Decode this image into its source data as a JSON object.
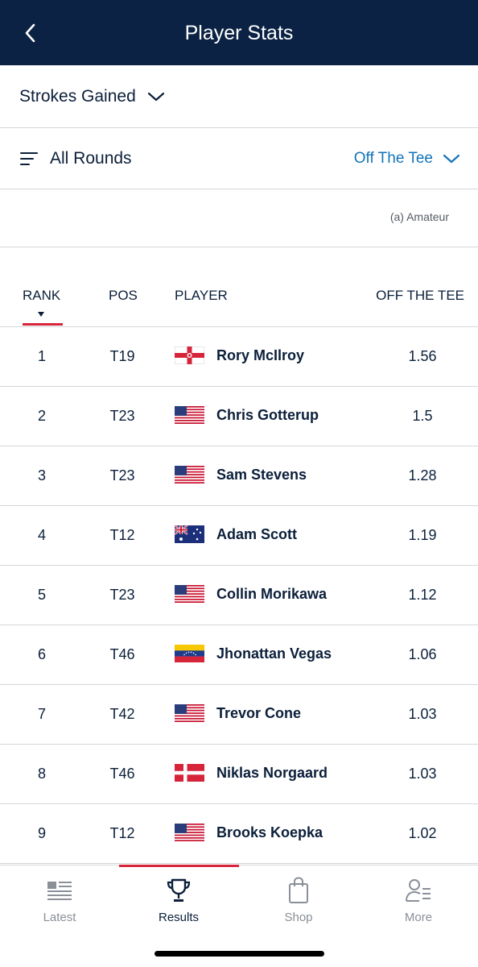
{
  "header": {
    "title": "Player Stats"
  },
  "stat_selector": {
    "label": "Strokes Gained"
  },
  "filters": {
    "rounds_label": "All Rounds",
    "category_label": "Off The Tee"
  },
  "note": "(a) Amateur",
  "columns": {
    "rank": "RANK",
    "pos": "POS",
    "player": "PLAYER",
    "stat": "OFF THE TEE"
  },
  "rows": [
    {
      "rank": "1",
      "pos": "T19",
      "flag": "northern-ireland",
      "name": "Rory McIlroy",
      "value": "1.56"
    },
    {
      "rank": "2",
      "pos": "T23",
      "flag": "usa",
      "name": "Chris Gotterup",
      "value": "1.5"
    },
    {
      "rank": "3",
      "pos": "T23",
      "flag": "usa",
      "name": "Sam Stevens",
      "value": "1.28"
    },
    {
      "rank": "4",
      "pos": "T12",
      "flag": "australia",
      "name": "Adam Scott",
      "value": "1.19"
    },
    {
      "rank": "5",
      "pos": "T23",
      "flag": "usa",
      "name": "Collin Morikawa",
      "value": "1.12"
    },
    {
      "rank": "6",
      "pos": "T46",
      "flag": "venezuela",
      "name": "Jhonattan Vegas",
      "value": "1.06"
    },
    {
      "rank": "7",
      "pos": "T42",
      "flag": "usa",
      "name": "Trevor Cone",
      "value": "1.03"
    },
    {
      "rank": "8",
      "pos": "T46",
      "flag": "denmark",
      "name": "Niklas Norgaard",
      "value": "1.03"
    },
    {
      "rank": "9",
      "pos": "T12",
      "flag": "usa",
      "name": "Brooks Koepka",
      "value": "1.02"
    }
  ],
  "tabs": [
    {
      "label": "Latest",
      "icon": "newspaper-icon"
    },
    {
      "label": "Results",
      "icon": "trophy-icon",
      "active": true
    },
    {
      "label": "Shop",
      "icon": "shopping-bag-icon"
    },
    {
      "label": "More",
      "icon": "profile-list-icon"
    }
  ],
  "colors": {
    "header_bg": "#0b2244",
    "accent": "#d6243a",
    "link": "#1474b8",
    "text": "#0b1f3a"
  }
}
